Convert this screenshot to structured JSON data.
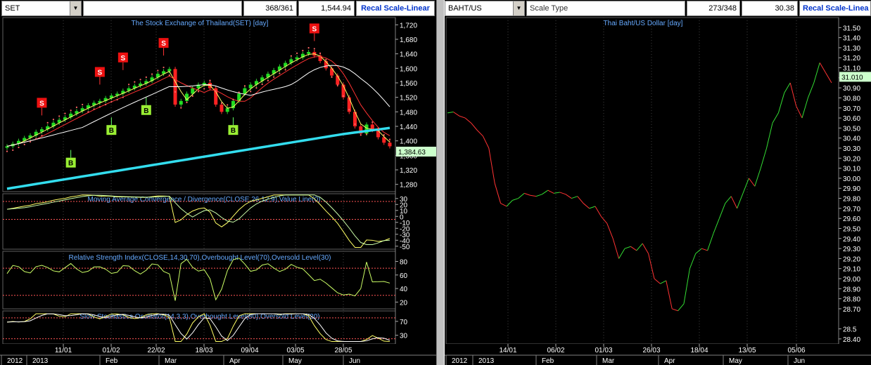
{
  "left": {
    "symbol": "SET",
    "counter": "368/361",
    "last_value": "1,544.94",
    "recal_label": "Recal Scale-Linear",
    "title": "The Stock Exchange of Thailand(SET) [day]",
    "price_label": "1,384.63",
    "price_axis": [
      "1,720",
      "1,680",
      "1,640",
      "1,600",
      "1,560",
      "1,520",
      "1,480",
      "1,440",
      "1,400",
      "1,360",
      "1,320",
      "1,280"
    ],
    "macd_title": "Moving Average Convergence / Divergence(CLOSE,26,12,9),Value Line(0)",
    "macd_axis": [
      "30",
      "20",
      "10",
      "0",
      "-10",
      "-20",
      "-30",
      "-40",
      "-50"
    ],
    "rsi_title": "Relative Strength Index(CLOSE,14,30,70),Overbought Level(70),Oversold Level(30)",
    "rsi_axis": [
      "80",
      "60",
      "40",
      "20"
    ],
    "stoch_title": "Slow Stochastics Oscillator(14,3,3),Overbought Level(80),Oversold Level(20)",
    "stoch_axis": [
      "70",
      "30"
    ],
    "date_labels": [
      "11/01",
      "01/02",
      "22/02",
      "18/03",
      "09/04",
      "03/05",
      "28/05"
    ],
    "month_labels": [
      "2012",
      "2013",
      "Feb",
      "Mar",
      "Apr",
      "May",
      "Jun"
    ],
    "signals": [
      "S",
      "S",
      "S",
      "S",
      "S",
      "B",
      "B",
      "B",
      "B",
      "S"
    ]
  },
  "right": {
    "symbol": "BAHT/US",
    "scale_type": "Scale Type",
    "counter": "273/348",
    "last_value": "30.38",
    "recal_label": "Recal Scale-Linea",
    "title": "Thai Baht/US Dollar [day]",
    "price_label": "31.010",
    "price_axis": [
      "31.50",
      "31.40",
      "31.30",
      "31.20",
      "31.10",
      "31.00",
      "30.90",
      "30.80",
      "30.70",
      "30.60",
      "30.50",
      "30.40",
      "30.30",
      "30.20",
      "30.10",
      "30.00",
      "29.90",
      "29.80",
      "29.70",
      "29.60",
      "29.50",
      "29.40",
      "29.30",
      "29.20",
      "29.10",
      "29.00",
      "28.90",
      "28.80",
      "28.70",
      "28.5",
      "28.40"
    ],
    "date_labels": [
      "14/01",
      "06/02",
      "01/03",
      "26/03",
      "18/04",
      "13/05",
      "05/06"
    ],
    "month_labels": [
      "2012",
      "2013",
      "Feb",
      "Mar",
      "Apr",
      "May",
      "Jun"
    ]
  },
  "chart_data": [
    {
      "type": "line",
      "title": "The Stock Exchange of Thailand(SET) [day]",
      "series": [
        {
          "values": [
            1385,
            1392,
            1400,
            1408,
            1415,
            1425,
            1432,
            1440,
            1450,
            1458,
            1465,
            1475,
            1482,
            1490,
            1498,
            1505,
            1510,
            1518,
            1525,
            1530,
            1538,
            1545,
            1552,
            1558,
            1565,
            1575,
            1585,
            1592,
            1598,
            1500,
            1510,
            1530,
            1545,
            1555,
            1560,
            1545,
            1500,
            1480,
            1490,
            1510,
            1530,
            1545,
            1555,
            1565,
            1575,
            1585,
            1595,
            1605,
            1615,
            1625,
            1630,
            1640,
            1645,
            1635,
            1620,
            1600,
            1580,
            1555,
            1520,
            1480,
            1440,
            1420,
            1445,
            1430,
            1410,
            1395,
            1385
          ]
        }
      ],
      "ylim": [
        1260,
        1740
      ]
    },
    {
      "type": "line",
      "title": "Thai Baht/US Dollar [day]",
      "series": [
        {
          "values": [
            30.65,
            30.66,
            30.62,
            30.6,
            30.55,
            30.48,
            30.42,
            30.3,
            29.95,
            29.75,
            29.72,
            29.78,
            29.8,
            29.85,
            29.83,
            29.82,
            29.84,
            29.88,
            29.85,
            29.86,
            29.84,
            29.8,
            29.82,
            29.75,
            29.7,
            29.72,
            29.62,
            29.55,
            29.4,
            29.2,
            29.3,
            29.32,
            29.28,
            29.35,
            29.25,
            29.0,
            28.95,
            28.98,
            28.7,
            28.68,
            28.75,
            29.1,
            29.25,
            29.3,
            29.28,
            29.45,
            29.6,
            29.75,
            29.82,
            29.7,
            29.85,
            30.0,
            29.92,
            30.1,
            30.3,
            30.55,
            30.65,
            30.85,
            30.95,
            30.72,
            30.6,
            30.8,
            30.95,
            31.15,
            31.05,
            30.95
          ]
        }
      ],
      "ylim": [
        28.35,
        31.6
      ]
    }
  ]
}
